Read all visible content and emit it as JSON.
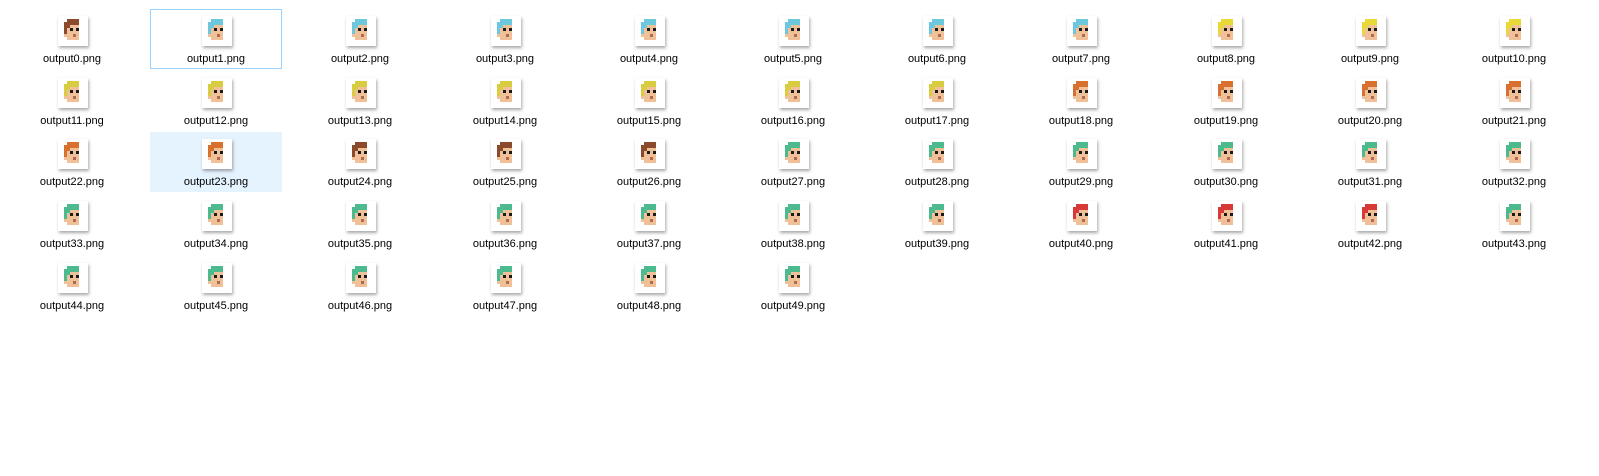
{
  "files": [
    {
      "name": "output0.png",
      "hair": "#8b4a2b"
    },
    {
      "name": "output1.png",
      "hair": "#6cc8dc",
      "focused": true
    },
    {
      "name": "output2.png",
      "hair": "#6cc8dc"
    },
    {
      "name": "output3.png",
      "hair": "#6cc8dc"
    },
    {
      "name": "output4.png",
      "hair": "#6cc8dc"
    },
    {
      "name": "output5.png",
      "hair": "#6cc8dc"
    },
    {
      "name": "output6.png",
      "hair": "#6cc8dc"
    },
    {
      "name": "output7.png",
      "hair": "#6cc8dc"
    },
    {
      "name": "output8.png",
      "hair": "#e8d838"
    },
    {
      "name": "output9.png",
      "hair": "#e8d838"
    },
    {
      "name": "output10.png",
      "hair": "#e8d838"
    },
    {
      "name": "output11.png",
      "hair": "#d8cc40"
    },
    {
      "name": "output12.png",
      "hair": "#d8cc40"
    },
    {
      "name": "output13.png",
      "hair": "#d8cc40"
    },
    {
      "name": "output14.png",
      "hair": "#d8cc40"
    },
    {
      "name": "output15.png",
      "hair": "#d8cc40"
    },
    {
      "name": "output16.png",
      "hair": "#d8cc40"
    },
    {
      "name": "output17.png",
      "hair": "#d8cc40"
    },
    {
      "name": "output18.png",
      "hair": "#d87030"
    },
    {
      "name": "output19.png",
      "hair": "#d87030"
    },
    {
      "name": "output20.png",
      "hair": "#d87030"
    },
    {
      "name": "output21.png",
      "hair": "#d87030"
    },
    {
      "name": "output22.png",
      "hair": "#d87030"
    },
    {
      "name": "output23.png",
      "hair": "#d87030",
      "selected": true
    },
    {
      "name": "output24.png",
      "hair": "#8b4a2b"
    },
    {
      "name": "output25.png",
      "hair": "#8b4a2b"
    },
    {
      "name": "output26.png",
      "hair": "#8b4a2b"
    },
    {
      "name": "output27.png",
      "hair": "#4cba8c"
    },
    {
      "name": "output28.png",
      "hair": "#4cba8c"
    },
    {
      "name": "output29.png",
      "hair": "#4cba8c"
    },
    {
      "name": "output30.png",
      "hair": "#4cba8c"
    },
    {
      "name": "output31.png",
      "hair": "#4cba8c"
    },
    {
      "name": "output32.png",
      "hair": "#4cba8c"
    },
    {
      "name": "output33.png",
      "hair": "#4cba8c"
    },
    {
      "name": "output34.png",
      "hair": "#4cba8c"
    },
    {
      "name": "output35.png",
      "hair": "#4cba8c"
    },
    {
      "name": "output36.png",
      "hair": "#4cba8c"
    },
    {
      "name": "output37.png",
      "hair": "#4cba8c"
    },
    {
      "name": "output38.png",
      "hair": "#4cba8c"
    },
    {
      "name": "output39.png",
      "hair": "#4cba8c"
    },
    {
      "name": "output40.png",
      "hair": "#d83838"
    },
    {
      "name": "output41.png",
      "hair": "#d83838"
    },
    {
      "name": "output42.png",
      "hair": "#d83838"
    },
    {
      "name": "output43.png",
      "hair": "#4cba8c"
    },
    {
      "name": "output44.png",
      "hair": "#4cba8c"
    },
    {
      "name": "output45.png",
      "hair": "#4cba8c"
    },
    {
      "name": "output46.png",
      "hair": "#4cba8c"
    },
    {
      "name": "output47.png",
      "hair": "#4cba8c"
    },
    {
      "name": "output48.png",
      "hair": "#4cba8c"
    },
    {
      "name": "output49.png",
      "hair": "#4cba8c"
    }
  ],
  "colors": {
    "skin": "#f0c098",
    "eye": "#1a1a1a",
    "mouth": "#b06a50",
    "focus_border": "#99d1ff",
    "selected_bg": "#e5f3ff"
  },
  "icon": "pixel-character-thumbnail"
}
